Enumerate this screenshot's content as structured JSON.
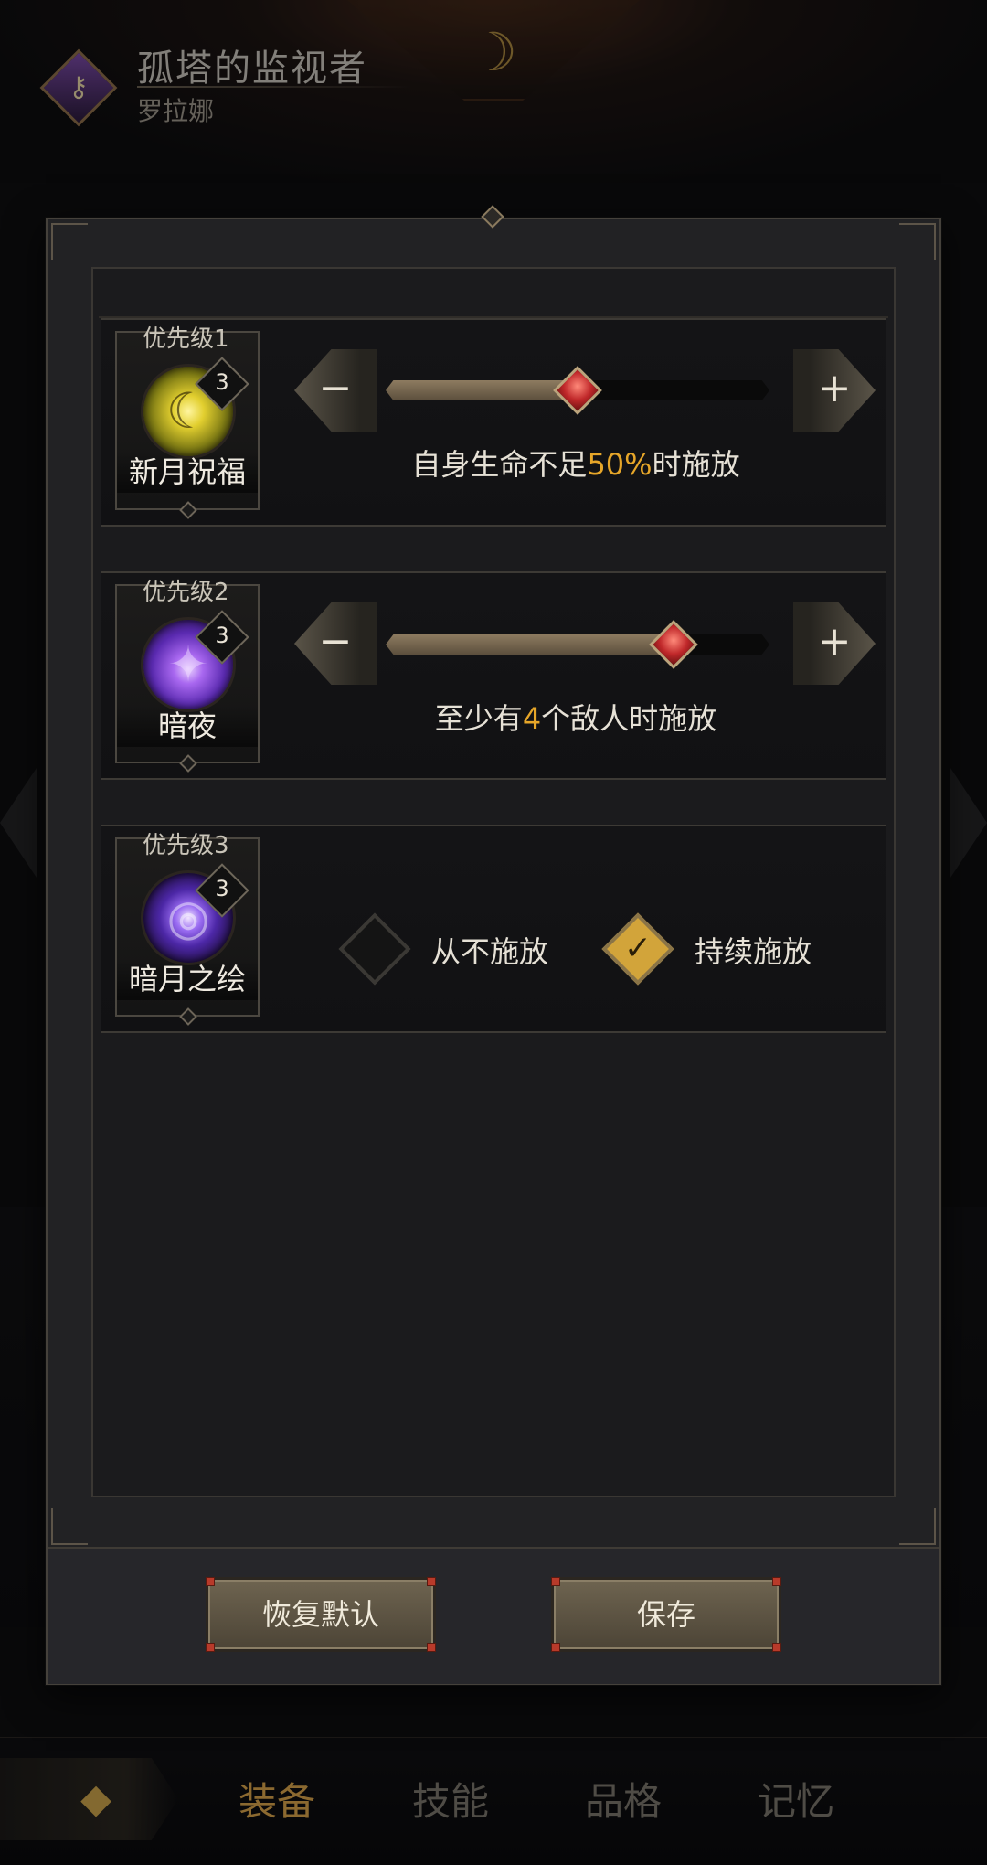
{
  "header": {
    "title": "孤塔的监视者",
    "subtitle": "罗拉娜"
  },
  "dialog": {
    "rows": [
      {
        "priority_label": "优先级1",
        "skill_name": "新月祝福",
        "level": "3",
        "icon": "crescent-blessing-icon",
        "desc_before": "自身生命不足",
        "desc_value": "50%",
        "desc_after": "时施放",
        "slider_fraction": 0.5
      },
      {
        "priority_label": "优先级2",
        "skill_name": "暗夜",
        "level": "3",
        "icon": "dark-night-icon",
        "desc_before": "至少有",
        "desc_value": "4",
        "desc_after": "个敌人时施放",
        "slider_fraction": 0.75
      },
      {
        "priority_label": "优先级3",
        "skill_name": "暗月之绘",
        "level": "3",
        "icon": "dark-moon-vortex-icon",
        "option_never": "从不施放",
        "option_always": "持续施放",
        "selected": "always"
      }
    ],
    "step_minus": "−",
    "step_plus": "+",
    "buttons": {
      "reset": "恢复默认",
      "save": "保存"
    }
  },
  "bottom_nav": {
    "tabs": [
      "装备",
      "技能",
      "品格",
      "记忆"
    ],
    "active_index": 0
  },
  "colors": {
    "highlight": "#e6a629",
    "dialog_bg": "#222224",
    "slider_thumb": "#c0282a"
  }
}
